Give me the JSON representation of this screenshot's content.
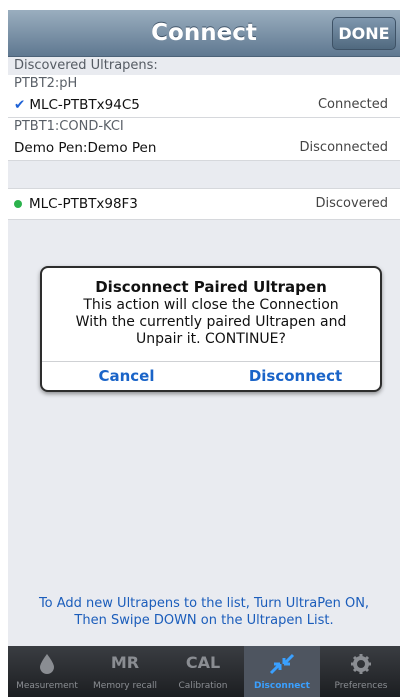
{
  "window": {
    "title": "Connect",
    "done_label": "DONE"
  },
  "list": {
    "section_header": "Discovered Ultrapens:",
    "rows": [
      {
        "sub": "PTBT2:pH",
        "name": "MLC-PTBTx94C5",
        "status": "Connected",
        "checked": true
      },
      {
        "sub": "PTBT1:COND-KCI",
        "name": "Demo Pen:Demo Pen",
        "status": "Disconnected"
      },
      {
        "name": "MLC-PTBTx98F3",
        "status": "Discovered",
        "indicator": "green-dot"
      }
    ]
  },
  "alert": {
    "title": "Disconnect Paired Ultrapen",
    "message_lines": [
      "This action will close the Connection",
      "With the currently paired Ultrapen and",
      "Unpair it. CONTINUE?"
    ],
    "cancel_label": "Cancel",
    "confirm_label": "Disconnect"
  },
  "hint": {
    "line1": "To Add new Ultrapens to the list, Turn UltraPen ON,",
    "line2": "Then Swipe DOWN on the Ultrapen List."
  },
  "tabs": [
    {
      "label": "Measurement",
      "icon": "drop-icon"
    },
    {
      "label": "Memory recall",
      "icon_text": "MR"
    },
    {
      "label": "Calibration",
      "icon_text": "CAL"
    },
    {
      "label": "Disconnect",
      "icon": "disconnect-arrows-icon",
      "active": true
    },
    {
      "label": "Preferences",
      "icon": "gear-icon"
    }
  ],
  "colors": {
    "accent": "#1b5dbb",
    "active_tab": "#3aa0ff",
    "status_ok": "#2bb24c"
  }
}
